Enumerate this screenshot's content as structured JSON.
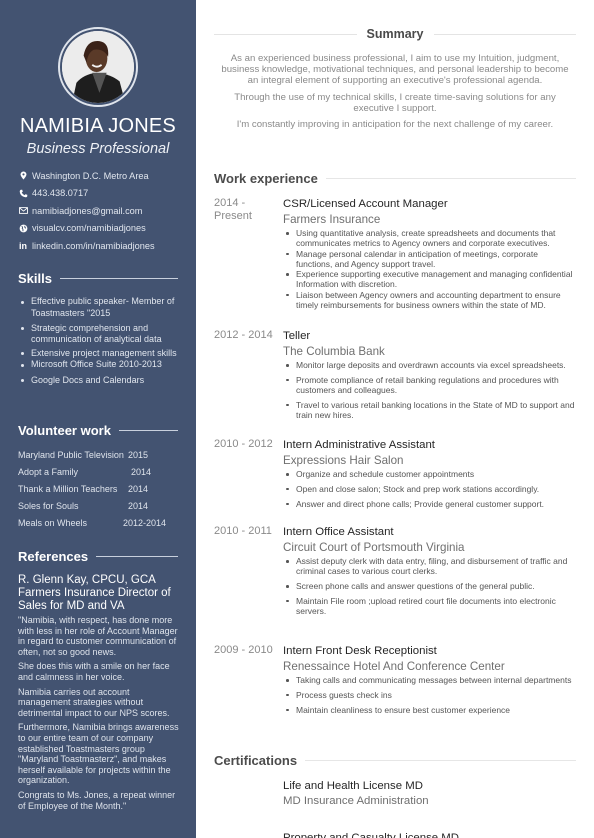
{
  "profile": {
    "name": "NAMIBIA JONES",
    "role": "Business Professional",
    "photo_alt": "Profile photo"
  },
  "contacts": [
    {
      "icon": "location-pin-icon",
      "text": "Washington D.C. Metro Area"
    },
    {
      "icon": "phone-icon",
      "text": "443.438.0717"
    },
    {
      "icon": "envelope-icon",
      "text": "namibiadjones@gmail.com"
    },
    {
      "icon": "globe-icon",
      "text": "visualcv.com/namibiadjones"
    },
    {
      "icon": "linkedin-icon",
      "text": "linkedin.com/in/namibiadjones"
    }
  ],
  "skills": {
    "heading": "Skills",
    "items": [
      "Effective public speaker- Member of Toastmasters \"2015",
      "Strategic comprehension and communication of analytical data",
      "Extensive project management skills",
      "Microsoft Office Suite 2010-2013",
      "Google Docs and Calendars"
    ]
  },
  "volunteer": {
    "heading": "Volunteer work",
    "items": [
      {
        "name": "Maryland Public Television",
        "year": "2015"
      },
      {
        "name": "Adopt a Family",
        "year": "2014"
      },
      {
        "name": "Thank a Million Teachers",
        "year": "2014"
      },
      {
        "name": "Soles for Souls",
        "year": "2014"
      },
      {
        "name": "Meals on Wheels",
        "year": "2012-2014"
      }
    ]
  },
  "references": {
    "heading": "References",
    "name": "R. Glenn Kay, CPCU, GCA Farmers Insurance Director of Sales for MD and VA",
    "paragraphs": [
      "\"Namibia, with respect, has done more with less in her role of Account Manager in  regard to customer communication of often, not so good news.",
      "She does this with a smile on her face and calmness in her voice.",
      "Namibia carries out account management strategies without detrimental impact to our NPS scores.",
      "Furthermore, Namibia brings awareness to our entire team of our company established Toastmasters group \"Maryland Toastmasterz\", and makes herself available for projects within the organization.",
      "Congrats to Ms. Jones, a repeat winner of Employee of the Month.\""
    ]
  },
  "summary": {
    "heading": "Summary",
    "paragraphs": [
      "As an experienced business professional, I aim to use my Intuition, judgment, business knowledge, motivational techniques, and personal leadership to become an integral element of supporting an executive's professional agenda.",
      "Through the use of my technical skills, I create time-saving solutions for any executive I support.",
      "I'm constantly improving in anticipation for the next challenge of my career."
    ]
  },
  "work": {
    "heading": "Work experience",
    "jobs": [
      {
        "dates": "2014 - Present",
        "title": "CSR/Licensed Account Manager",
        "company": "Farmers Insurance",
        "bullets": [
          "Using quantitative analysis, create spreadsheets and documents that communicates metrics to Agency owners and corporate executives.",
          "Manage personal calendar in anticipation of meetings, corporate functions, and Agency support travel.",
          "Experience supporting executive management and managing confidential Information with discretion.",
          "Liaison between Agency owners and accounting department to ensure timely reimbursements for business owners within the state of MD."
        ]
      },
      {
        "dates": "2012 - 2014",
        "title": "Teller",
        "company": "The Columbia Bank",
        "bullets": [
          "Monitor large deposits and overdrawn accounts via excel spreadsheets.",
          "Promote compliance of retail banking regulations and procedures with customers and colleagues.",
          "Travel to various retail banking locations in the State of MD to support and train new hires."
        ]
      },
      {
        "dates": "2010 - 2012",
        "title": "Intern Administrative Assistant",
        "company": "Expressions Hair Salon",
        "bullets": [
          "Organize and schedule customer appointments",
          "Open and close salon; Stock and prep work stations accordingly.",
          "Answer and direct phone calls; Provide general customer support."
        ]
      },
      {
        "dates": "2010 - 2011",
        "title": "Intern Office Assistant",
        "company": "Circuit Court of Portsmouth Virginia",
        "bullets": [
          "Assist deputy clerk with data entry, filing, and disbursement of traffic and criminal cases to various court clerks.",
          "Screen phone calls  and answer questions of the general public.",
          "Maintain File room ;upload retired court file documents into electronic servers."
        ]
      },
      {
        "dates": "2009 - 2010",
        "title": "Intern Front Desk Receptionist",
        "company": "Renessaince Hotel And Conference Center",
        "bullets": [
          "Taking calls and communicating messages between internal departments",
          "Process guests check ins",
          "Maintain cleanliness to ensure best customer experience"
        ]
      }
    ]
  },
  "certifications": {
    "heading": "Certifications",
    "items": [
      {
        "title": "Life and Health License MD",
        "issuer": "MD Insurance Administration"
      },
      {
        "title": "Property and Casualty License MD",
        "issuer": ""
      }
    ]
  }
}
